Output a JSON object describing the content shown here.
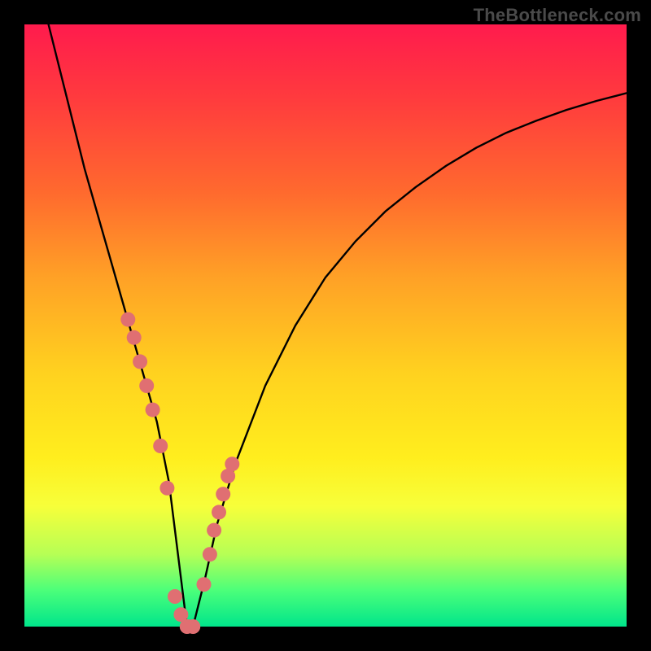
{
  "watermark": "TheBottleneck.com",
  "chart_data": {
    "type": "line",
    "title": "",
    "xlabel": "",
    "ylabel": "",
    "xlim": [
      0,
      100
    ],
    "ylim": [
      0,
      100
    ],
    "grid": false,
    "series": [
      {
        "name": "bottleneck-curve",
        "x": [
          4,
          6,
          8,
          10,
          12,
          14,
          16,
          18,
          20,
          22,
          24,
          25.5,
          27,
          28,
          30,
          32,
          35,
          40,
          45,
          50,
          55,
          60,
          65,
          70,
          75,
          80,
          85,
          90,
          95,
          100
        ],
        "values": [
          100,
          92,
          84,
          76,
          69,
          62,
          55,
          48,
          41,
          34,
          24,
          12,
          0,
          0,
          8,
          17,
          27,
          40,
          50,
          58,
          64,
          69,
          73,
          76.5,
          79.5,
          82,
          84,
          85.8,
          87.3,
          88.6
        ],
        "color": "#000000",
        "style": "solid"
      }
    ],
    "points_overlay": {
      "name": "highlight-dots",
      "color": "#e06f72",
      "radius_px": 9,
      "x": [
        17.2,
        18.2,
        19.2,
        20.3,
        21.3,
        22.6,
        23.7,
        25.0,
        26.0,
        27.0,
        28.0,
        29.8,
        30.8,
        31.5,
        32.3,
        33.0,
        33.8,
        34.5
      ],
      "y": [
        51,
        48,
        44,
        40,
        36,
        30,
        23,
        5,
        2,
        0,
        0,
        7,
        12,
        16,
        19,
        22,
        25,
        27
      ]
    },
    "gradient_bands": {
      "comment": "Vertical gradient background encodes bottleneck severity from top (worst) to bottom (best)",
      "stops": [
        {
          "pos": 0.0,
          "color": "#ff1b4d"
        },
        {
          "pos": 0.12,
          "color": "#ff3a3e"
        },
        {
          "pos": 0.28,
          "color": "#ff6a2e"
        },
        {
          "pos": 0.42,
          "color": "#ffa126"
        },
        {
          "pos": 0.58,
          "color": "#ffd21f"
        },
        {
          "pos": 0.72,
          "color": "#ffee1e"
        },
        {
          "pos": 0.8,
          "color": "#f7ff3a"
        },
        {
          "pos": 0.88,
          "color": "#b6ff55"
        },
        {
          "pos": 0.94,
          "color": "#4bff7a"
        },
        {
          "pos": 1.0,
          "color": "#00e58b"
        }
      ]
    }
  }
}
